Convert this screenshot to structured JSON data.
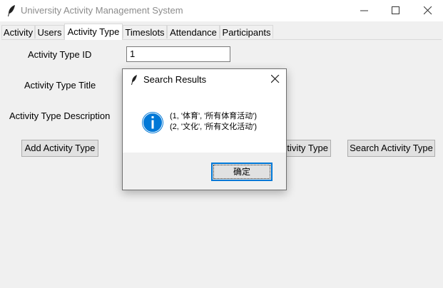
{
  "window": {
    "title": "University Activity Management System",
    "icon": "feather-icon"
  },
  "tabs": [
    {
      "label": "Activity"
    },
    {
      "label": "Users"
    },
    {
      "label": "Activity Type",
      "active": true
    },
    {
      "label": "Timeslots"
    },
    {
      "label": "Attendance"
    },
    {
      "label": "Participants"
    }
  ],
  "form": {
    "id_label": "Activity Type ID",
    "id_value": "1",
    "title_label": "Activity Type Title",
    "description_label": "Activity Type Description"
  },
  "buttons": {
    "add": "Add Activity Type",
    "partial": "Activity Type",
    "search": "Search Activity Type"
  },
  "dialog": {
    "title": "Search Results",
    "icon": "info-icon",
    "message_lines": [
      "(1, '体育', '所有体育活动')",
      "(2, '文化', '所有文化活动')"
    ],
    "ok_label": "确定"
  },
  "colors": {
    "accent": "#0078d7",
    "info_icon": "#0078d7"
  }
}
